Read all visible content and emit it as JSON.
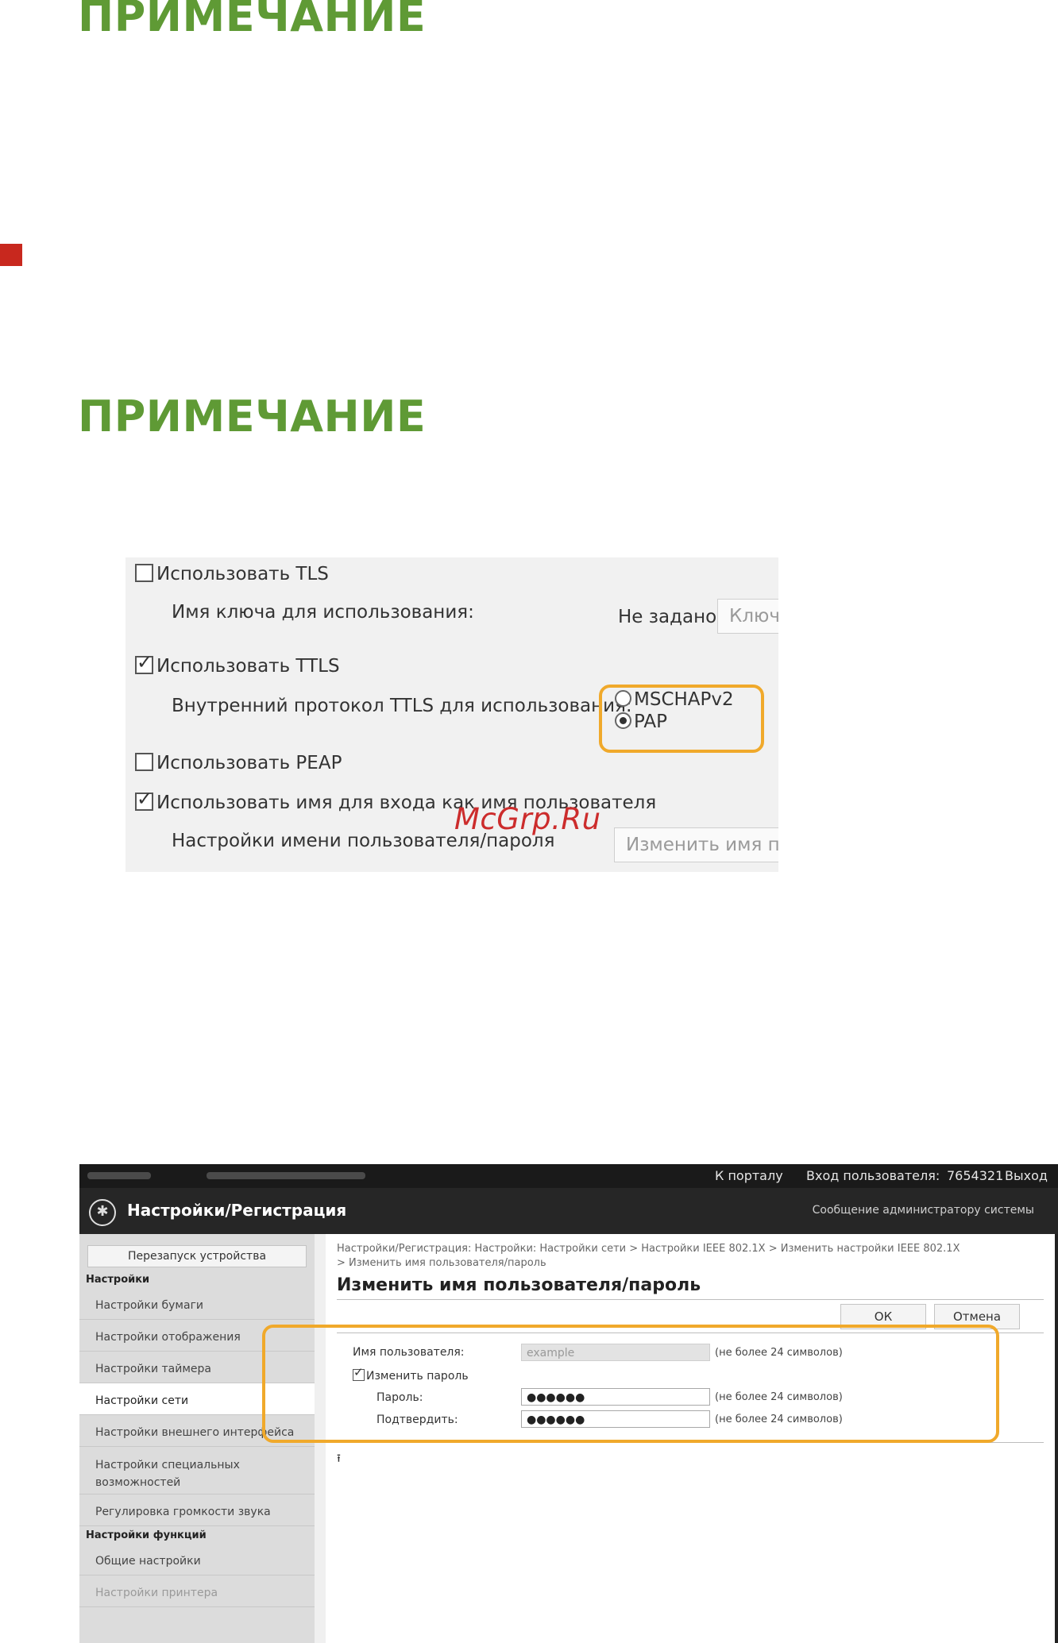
{
  "headings": {
    "note1": "ПРИМЕЧАНИЕ",
    "note2": "ПРИМЕЧАНИЕ"
  },
  "colors": {
    "heading_green": "#5f9a35",
    "highlight_orange": "#f0a92b",
    "red_marker": "#c8281e"
  },
  "ttls_panel": {
    "use_tls": {
      "label": "Использовать TLS",
      "checked": false
    },
    "key_name_label": "Имя ключа для использования:",
    "key_value": "Не задано.",
    "key_button": "Ключ",
    "use_ttls": {
      "label": "Использовать TTLS",
      "checked": true
    },
    "ttls_protocol_label": "Внутренний протокол TTLS для использования:",
    "ttls_options": [
      {
        "label": "MSCHAPv2",
        "selected": false
      },
      {
        "label": "PAP",
        "selected": true
      }
    ],
    "use_peap": {
      "label": "Использовать PEAP",
      "checked": false
    },
    "use_login_name": {
      "label": "Использовать имя для входа как имя пользователя",
      "checked": true
    },
    "credentials_label": "Настройки имени пользователя/пароля",
    "change_button": "Изменить имя по"
  },
  "watermark": "McGrp.Ru",
  "remote_ui": {
    "topbar": {
      "portal_link": "К порталу",
      "user_login_label": "Вход пользователя:",
      "user_id": "7654321",
      "logout": "Выход"
    },
    "header": {
      "title": "Настройки/Регистрация",
      "admin_message": "Сообщение администратору системы"
    },
    "sidebar": {
      "restart_button": "Перезапуск устройства",
      "section_settings": "Настройки",
      "items": [
        "Настройки бумаги",
        "Настройки отображения",
        "Настройки таймера",
        "Настройки сети",
        "Настройки внешнего интерфейса",
        "Настройки специальных возможностей",
        "Регулировка громкости звука"
      ],
      "active_item": "Настройки сети",
      "section_functions": "Настройки функций",
      "function_items": [
        "Общие настройки",
        "Настройки принтера"
      ]
    },
    "content": {
      "breadcrumb_line1": "Настройки/Регистрация: Настройки: Настройки сети > Настройки IEEE 802.1X > Изменить настройки IEEE 802.1X",
      "breadcrumb_line2": "> Изменить имя пользователя/пароль",
      "title": "Изменить имя пользователя/пароль",
      "ok_button": "ОК",
      "cancel_button": "Отмена",
      "username_label": "Имя пользователя:",
      "username_value": "example",
      "username_note": "(не более 24 символов)",
      "change_password_label": "Изменить пароль",
      "change_password_checked": true,
      "password_label": "Пароль:",
      "password_value": "●●●●●●",
      "password_note": "(не более 24 символов)",
      "confirm_label": "Подтвердить:",
      "confirm_value": "●●●●●●",
      "confirm_note": "(не более 24 символов)",
      "to_top_icon": "⭱"
    }
  }
}
